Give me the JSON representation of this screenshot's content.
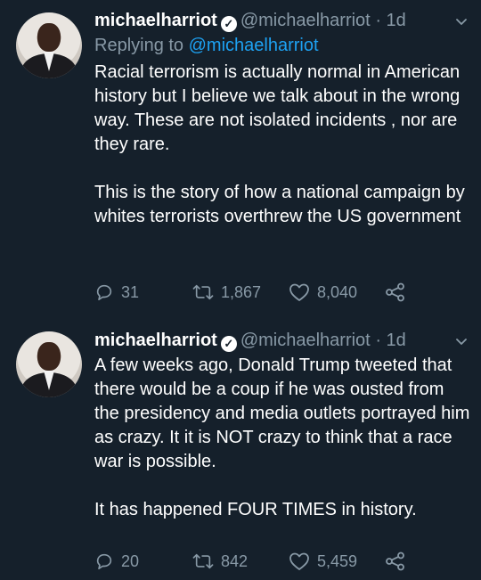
{
  "tweets": [
    {
      "name": "michaelharriot",
      "handle": "@michaelharriot",
      "dot": "·",
      "time": "1d",
      "replying_prefix": "Replying to",
      "replying_to": "@michaelharriot",
      "paragraphs": [
        "Racial terrorism is actually normal in American history but I believe we talk about in the wrong way.  These are not isolated incidents , nor are they rare.",
        "This is the story of how a national campaign by whites terrorists overthrew the US government"
      ],
      "replies": "31",
      "retweets": "1,867",
      "likes": "8,040"
    },
    {
      "name": "michaelharriot",
      "handle": "@michaelharriot",
      "dot": "·",
      "time": "1d",
      "paragraphs": [
        "A few weeks ago, Donald Trump tweeted that there would be a coup if he was ousted from the presidency and media outlets portrayed him as crazy. It it is NOT crazy to think that a race war is possible.",
        "It has happened FOUR TIMES in history."
      ],
      "replies": "20",
      "retweets": "842",
      "likes": "5,459"
    }
  ],
  "colors": {
    "background": "#15202b",
    "muted": "#8899a6",
    "link": "#1da1f2",
    "text": "#ffffff"
  }
}
